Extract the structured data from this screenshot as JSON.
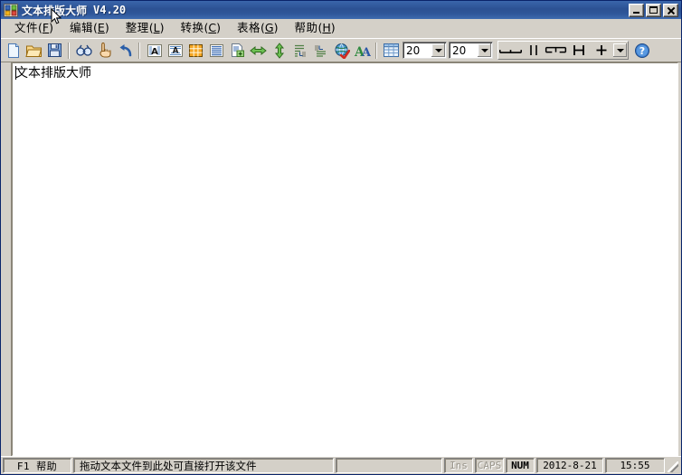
{
  "window": {
    "title": "文本排版大师",
    "version": "V4.20",
    "icon": "app-blocks-icon",
    "controls": {
      "minimize": "minimize-button",
      "maximize": "maximize-button",
      "close": "close-button"
    },
    "titlebar_color": "#2f5699",
    "chrome_color": "#d4d0c8"
  },
  "menubar": {
    "items": [
      {
        "label": "文件",
        "hotkey": "F"
      },
      {
        "label": "编辑",
        "hotkey": "E"
      },
      {
        "label": "整理",
        "hotkey": "L"
      },
      {
        "label": "转换",
        "hotkey": "C"
      },
      {
        "label": "表格",
        "hotkey": "G"
      },
      {
        "label": "帮助",
        "hotkey": "H"
      }
    ]
  },
  "toolbar": {
    "buttons": [
      {
        "name": "new-document-icon"
      },
      {
        "name": "open-folder-icon"
      },
      {
        "name": "save-floppy-icon"
      },
      {
        "name": "separator"
      },
      {
        "name": "find-binoculars-icon"
      },
      {
        "name": "hand-pointer-icon"
      },
      {
        "name": "undo-arrow-icon"
      },
      {
        "name": "separator"
      },
      {
        "name": "columns-text-icon"
      },
      {
        "name": "center-text-icon"
      },
      {
        "name": "grid-orange-icon"
      },
      {
        "name": "lines-blue-icon"
      },
      {
        "name": "document-export-icon"
      },
      {
        "name": "arrows-horizontal-icon"
      },
      {
        "name": "arrows-vertical-icon"
      },
      {
        "name": "indent-left-icon"
      },
      {
        "name": "indent-right-icon"
      },
      {
        "name": "globe-check-icon"
      },
      {
        "name": "font-case-icon"
      },
      {
        "name": "separator"
      },
      {
        "name": "table-grid-icon"
      }
    ],
    "combo_rows": {
      "value": "20",
      "label": "rows-combo"
    },
    "combo_cols": {
      "value": "20",
      "label": "cols-combo"
    },
    "border_tools": [
      {
        "name": "border-bottom-icon"
      },
      {
        "name": "border-vertical-icon"
      },
      {
        "name": "border-top-icon"
      },
      {
        "name": "border-cross-h-icon"
      },
      {
        "name": "border-plus-icon"
      }
    ],
    "border_dropdown": "border-style-dropdown",
    "help_button": "help-question-icon"
  },
  "editor": {
    "content": "文本排版大师",
    "caret_visible": true,
    "background": "#ffffff"
  },
  "statusbar": {
    "help_key": "F1 帮助",
    "hint": "拖动文本文件到此处可直接打开该文件",
    "indicators": [
      {
        "label": "Ins",
        "active": false
      },
      {
        "label": "CAPS",
        "active": false
      },
      {
        "label": "NUM",
        "active": true
      }
    ],
    "date": "2012-8-21",
    "time": "15:55"
  }
}
